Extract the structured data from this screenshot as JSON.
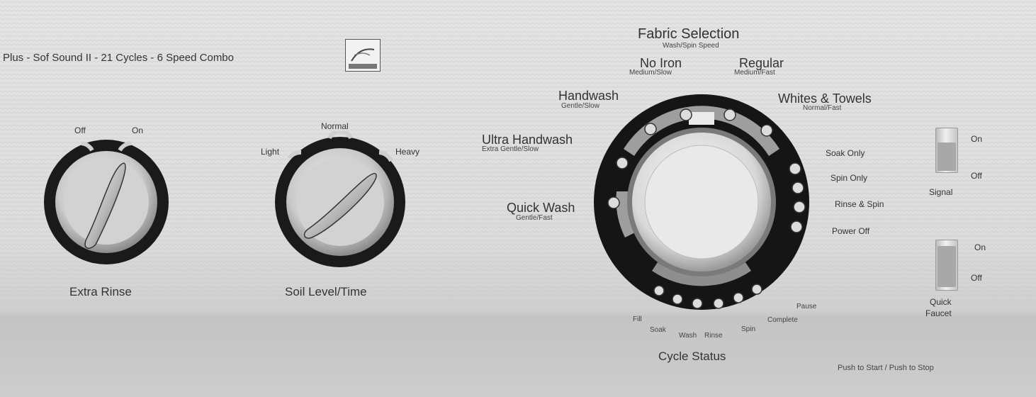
{
  "header": {
    "model_text": "Plus - Sof Sound II - 21 Cycles - 6 Speed Combo",
    "logo_icon": "energy-star-logo-icon"
  },
  "extra_rinse": {
    "title": "Extra Rinse",
    "off": "Off",
    "on": "On"
  },
  "soil_level": {
    "title": "Soil Level/Time",
    "light": "Light",
    "normal": "Normal",
    "heavy": "Heavy"
  },
  "fabric": {
    "title": "Fabric Selection",
    "subtitle": "Wash/Spin Speed",
    "options": [
      {
        "name": "No Iron",
        "speed": "Medium/Slow"
      },
      {
        "name": "Regular",
        "speed": "Medium/Fast"
      },
      {
        "name": "Handwash",
        "speed": "Gentle/Slow"
      },
      {
        "name": "Whites & Towels",
        "speed": "Normal/Fast"
      },
      {
        "name": "Ultra Handwash",
        "speed": "Extra Gentle/Slow"
      },
      {
        "name": "Quick Wash",
        "speed": "Gentle/Fast"
      }
    ]
  },
  "right_positions": [
    "Soak Only",
    "Spin Only",
    "Rinse & Spin",
    "Power Off"
  ],
  "cycle_status": {
    "title": "Cycle Status",
    "steps": [
      "Fill",
      "Soak",
      "Wash",
      "Rinse",
      "Spin",
      "Complete",
      "Pause"
    ]
  },
  "signal": {
    "label": "Signal",
    "on": "On",
    "off": "Off"
  },
  "quick_faucet": {
    "label_line1": "Quick",
    "label_line2": "Faucet",
    "on": "On",
    "off": "Off"
  },
  "push_text": "Push to Start / Push to Stop"
}
